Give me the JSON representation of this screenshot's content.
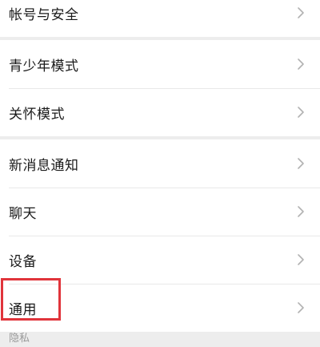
{
  "settings": {
    "group1": [
      {
        "label": "帐号与安全"
      }
    ],
    "group2": [
      {
        "label": "青少年模式"
      },
      {
        "label": "关怀模式"
      }
    ],
    "group3": [
      {
        "label": "新消息通知"
      },
      {
        "label": "聊天"
      },
      {
        "label": "设备"
      },
      {
        "label": "通用"
      }
    ],
    "next_section_header": "隐私"
  },
  "icons": {
    "row_chevron": "chevron-right-icon"
  },
  "colors": {
    "page_background": "#ededed",
    "row_background": "#ffffff",
    "highlight_border": "#e0343b",
    "chevron": "#b2b2b2"
  }
}
